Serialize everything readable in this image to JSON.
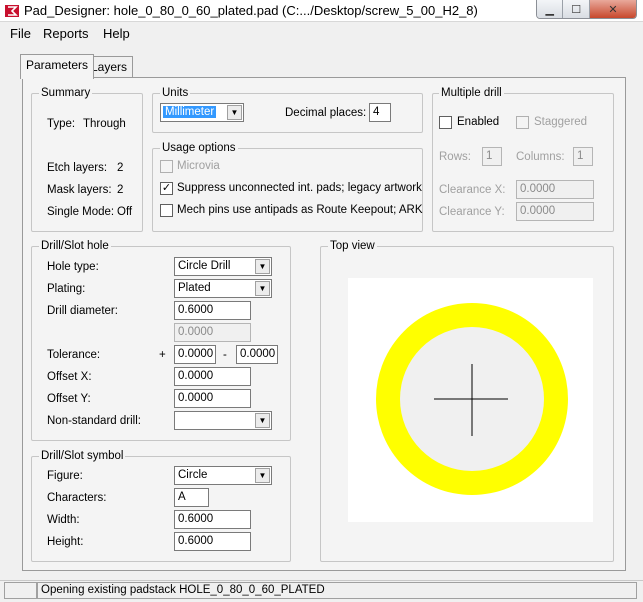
{
  "window": {
    "title": "Pad_Designer: hole_0_80_0_60_plated.pad (C:.../Desktop/screw_5_00_H2_8)"
  },
  "menu": [
    "File",
    "Reports",
    "Help"
  ],
  "tabs": {
    "parameters": "Parameters",
    "layers": "Layers"
  },
  "summary": {
    "legend": "Summary",
    "type_label": "Type:",
    "type_value": "Through",
    "etch_label": "Etch layers:",
    "etch_value": "2",
    "mask_label": "Mask layers:",
    "mask_value": "2",
    "single_label": "Single Mode:",
    "single_value": "Off"
  },
  "units": {
    "legend": "Units",
    "unit_value": "Millimeter",
    "decimal_label": "Decimal places:",
    "decimal_value": "4"
  },
  "usage": {
    "legend": "Usage options",
    "microvia": "Microvia",
    "suppress": "Suppress unconnected int. pads; legacy artwork",
    "mech": "Mech pins use antipads as Route Keepout; ARK",
    "microvia_checked": false,
    "suppress_checked": true,
    "mech_checked": false
  },
  "multi": {
    "legend": "Multiple drill",
    "enabled": "Enabled",
    "staggered": "Staggered",
    "rows_label": "Rows:",
    "rows_value": "1",
    "cols_label": "Columns:",
    "cols_value": "1",
    "clrx_label": "Clearance X:",
    "clrx_value": "0.0000",
    "clry_label": "Clearance Y:",
    "clry_value": "0.0000"
  },
  "drill": {
    "legend": "Drill/Slot hole",
    "hole_type_label": "Hole type:",
    "hole_type_value": "Circle Drill",
    "plating_label": "Plating:",
    "plating_value": "Plated",
    "diameter_label": "Drill diameter:",
    "diameter_value": "0.6000",
    "diameter2_value": "0.0000",
    "tolerance_label": "Tolerance:",
    "tol_plus": "+",
    "tol_minus": "-",
    "tol_plus_value": "0.0000",
    "tol_minus_value": "0.0000",
    "offx_label": "Offset X:",
    "offx_value": "0.0000",
    "offy_label": "Offset Y:",
    "offy_value": "0.0000",
    "nonstd_label": "Non-standard drill:",
    "nonstd_value": ""
  },
  "symbol": {
    "legend": "Drill/Slot symbol",
    "figure_label": "Figure:",
    "figure_value": "Circle",
    "chars_label": "Characters:",
    "chars_value": "A",
    "width_label": "Width:",
    "width_value": "0.6000",
    "height_label": "Height:",
    "height_value": "0.6000"
  },
  "topview": {
    "legend": "Top view",
    "pad_color": "#ffff00",
    "hole_color": "#f0f0f0",
    "crosshair_color": "#000000"
  },
  "status": {
    "message": "Opening existing padstack HOLE_0_80_0_60_PLATED"
  }
}
